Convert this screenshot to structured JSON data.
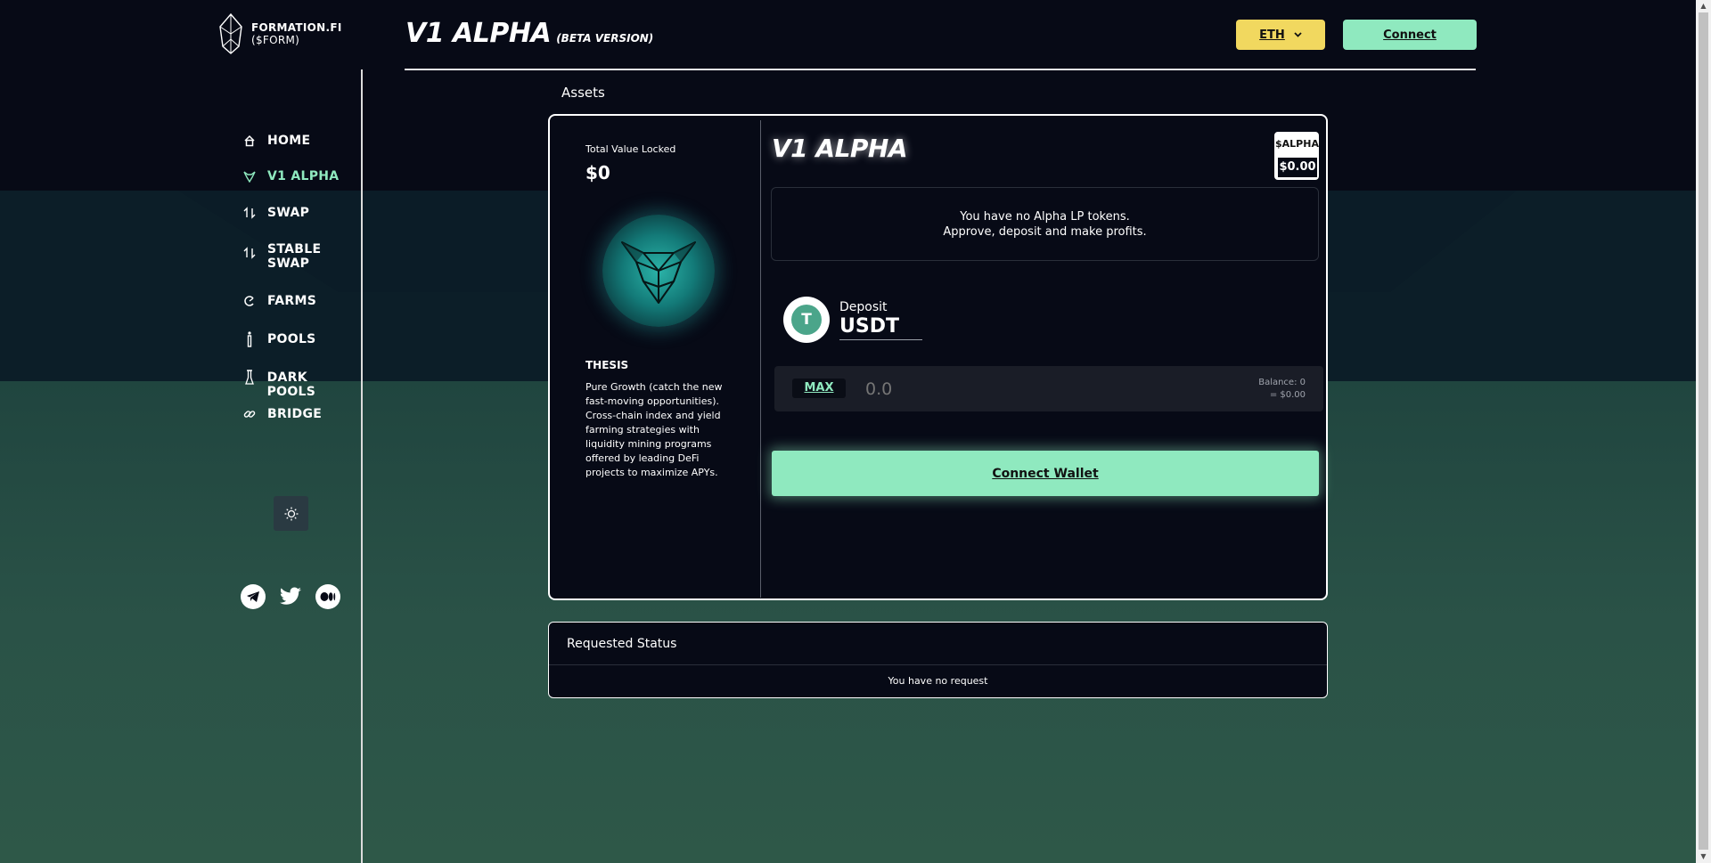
{
  "brand": {
    "name": "FORMATION.FI",
    "ticker": "($FORM)"
  },
  "header": {
    "title": "V1 ALPHA",
    "subtitle": "(BETA VERSION)",
    "network_label": "ETH",
    "connect_label": "Connect"
  },
  "sidebar": {
    "items": [
      {
        "label": "HOME",
        "icon": "home-icon"
      },
      {
        "label": "V1 ALPHA",
        "icon": "bull-icon",
        "active": true
      },
      {
        "label": "SWAP",
        "icon": "swap-icon"
      },
      {
        "label": "STABLE SWAP",
        "icon": "swap-icon"
      },
      {
        "label": "FARMS",
        "icon": "farm-icon"
      },
      {
        "label": "POOLS",
        "icon": "flask-icon"
      },
      {
        "label": "DARK POOLS",
        "icon": "flask-icon"
      },
      {
        "label": "BRIDGE",
        "icon": "link-icon"
      }
    ],
    "theme_toggle_icon": "sun-icon",
    "socials": [
      "telegram-icon",
      "twitter-icon",
      "medium-icon"
    ]
  },
  "section": {
    "label": "Assets"
  },
  "fund": {
    "tvl_label": "Total Value Locked",
    "tvl_value": "$0",
    "thesis_title": "THESIS",
    "thesis_text": "Pure Growth (catch the new fast-moving opportunities). Cross-chain index and yield farming strategies with liquidity mining programs offered by leading DeFi projects to maximize APYs.",
    "title": "V1 ALPHA",
    "token_symbol": "$ALPHA",
    "token_price": "$0.00",
    "info_line1": "You have no Alpha LP tokens.",
    "info_line2": "Approve, deposit and make profits.",
    "deposit_label": "Deposit",
    "deposit_token": "USDT",
    "coin_glyph": "T",
    "max_label": "MAX",
    "amount_placeholder": "0.0",
    "balance_line1": "Balance: 0",
    "balance_line2": "= $0.00",
    "connect_wallet_label": "Connect Wallet"
  },
  "status": {
    "title": "Requested Status",
    "empty": "You have no request"
  },
  "colors": {
    "accent": "#8fe9bf",
    "network": "#f1d85f",
    "background": "#070a16"
  }
}
